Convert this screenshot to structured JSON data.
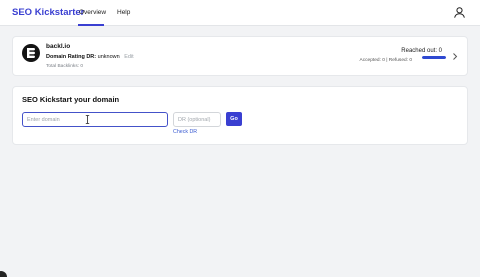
{
  "header": {
    "brand": "SEO Kickstarter",
    "tabs": [
      {
        "label": "Overview",
        "active": true
      },
      {
        "label": "Help",
        "active": false
      }
    ],
    "user_icon": "user-icon",
    "accent_color": "#3a3fd1"
  },
  "domain_card": {
    "domain": "backl.io",
    "domain_rating_label": "Domain Rating DR:",
    "domain_rating_value": "unknown",
    "edit_label": "Edit",
    "total_backlinks": "Total Backlinks: 0",
    "reached_out": "Reached out: 0",
    "accepted_refused": "Accepted: 0 | Refused: 0",
    "progress_fraction": 1.0,
    "logo_icon": "backlio-logo",
    "chevron_icon": "chevron-right-icon"
  },
  "kickstart": {
    "title": "SEO Kickstart your domain",
    "domain_placeholder": "Enter domain",
    "domain_value": "",
    "dr_placeholder": "DR (optional)",
    "go_label": "Go",
    "check_dr_label": "Check DR"
  }
}
